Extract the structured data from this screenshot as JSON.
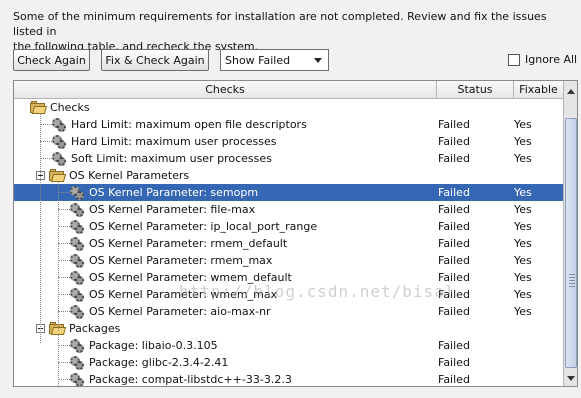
{
  "intro": {
    "line1": "Some of the minimum requirements for installation are not completed. Review and fix the issues listed in",
    "line2": "the following table, and recheck the system."
  },
  "toolbar": {
    "check_again": "Check Again",
    "fix_check_again": "Fix & Check Again",
    "filter_value": "Show Failed",
    "ignore_all": "Ignore All",
    "ignore_all_checked": false
  },
  "table": {
    "columns": [
      "Checks",
      "Status",
      "Fixable"
    ],
    "rows": [
      {
        "name": "Checks",
        "status": "",
        "fixable": "",
        "type": "folder",
        "level": 0,
        "expanded": true
      },
      {
        "name": "Hard Limit: maximum open file descriptors",
        "status": "Failed",
        "fixable": "Yes",
        "type": "check",
        "level": 1
      },
      {
        "name": "Hard Limit: maximum user processes",
        "status": "Failed",
        "fixable": "Yes",
        "type": "check",
        "level": 1
      },
      {
        "name": "Soft Limit: maximum user processes",
        "status": "Failed",
        "fixable": "Yes",
        "type": "check",
        "level": 1
      },
      {
        "name": "OS Kernel Parameters",
        "status": "",
        "fixable": "",
        "type": "folder",
        "level": 1,
        "expanded": true
      },
      {
        "name": "OS Kernel Parameter: semopm",
        "status": "Failed",
        "fixable": "Yes",
        "type": "check",
        "level": 2,
        "selected": true
      },
      {
        "name": "OS Kernel Parameter: file-max",
        "status": "Failed",
        "fixable": "Yes",
        "type": "check",
        "level": 2
      },
      {
        "name": "OS Kernel Parameter: ip_local_port_range",
        "status": "Failed",
        "fixable": "Yes",
        "type": "check",
        "level": 2
      },
      {
        "name": "OS Kernel Parameter: rmem_default",
        "status": "Failed",
        "fixable": "Yes",
        "type": "check",
        "level": 2
      },
      {
        "name": "OS Kernel Parameter: rmem_max",
        "status": "Failed",
        "fixable": "Yes",
        "type": "check",
        "level": 2
      },
      {
        "name": "OS Kernel Parameter: wmem_default",
        "status": "Failed",
        "fixable": "Yes",
        "type": "check",
        "level": 2
      },
      {
        "name": "OS Kernel Parameter: wmem_max",
        "status": "Failed",
        "fixable": "Yes",
        "type": "check",
        "level": 2
      },
      {
        "name": "OS Kernel Parameter: aio-max-nr",
        "status": "Failed",
        "fixable": "Yes",
        "type": "check",
        "level": 2
      },
      {
        "name": "Packages",
        "status": "",
        "fixable": "",
        "type": "folder",
        "level": 1,
        "expanded": true
      },
      {
        "name": "Package: libaio-0.3.105",
        "status": "Failed",
        "fixable": "",
        "type": "check",
        "level": 2
      },
      {
        "name": "Package: glibc-2.3.4-2.41",
        "status": "Failed",
        "fixable": "",
        "type": "check",
        "level": 2
      },
      {
        "name": "Package: compat-libstdc++-33-3.2.3",
        "status": "Failed",
        "fixable": "",
        "type": "check",
        "level": 2
      }
    ]
  },
  "watermark": "http://blog.csdn.net/bisal",
  "colors": {
    "selection": "#3567b4",
    "background": "#f1f1f1"
  }
}
